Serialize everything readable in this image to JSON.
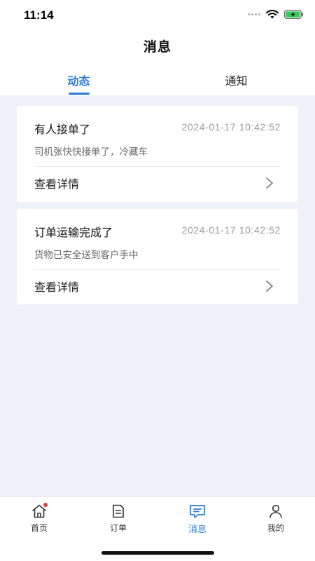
{
  "status": {
    "time": "11:14"
  },
  "header": {
    "title": "消息",
    "tabs": [
      {
        "label": "动态",
        "active": true
      },
      {
        "label": "通知",
        "active": false
      }
    ]
  },
  "messages": [
    {
      "title": "有人接单了",
      "time": "2024-01-17 10:42:52",
      "description": "司机张快快接单了，冷藏车",
      "link": "查看详情"
    },
    {
      "title": "订单运输完成了",
      "time": "2024-01-17 10:42:52",
      "description": "货物已安全送到客户手中",
      "link": "查看详情"
    }
  ],
  "tabbar": {
    "items": [
      {
        "label": "首页",
        "icon": "home-icon",
        "has_badge": true
      },
      {
        "label": "订单",
        "icon": "order-icon"
      },
      {
        "label": "消息",
        "icon": "message-icon",
        "active": true
      },
      {
        "label": "我的",
        "icon": "profile-icon"
      }
    ]
  },
  "colors": {
    "accent": "#2d7ad6",
    "background": "#eef2f8",
    "badge": "#e03b3b"
  }
}
